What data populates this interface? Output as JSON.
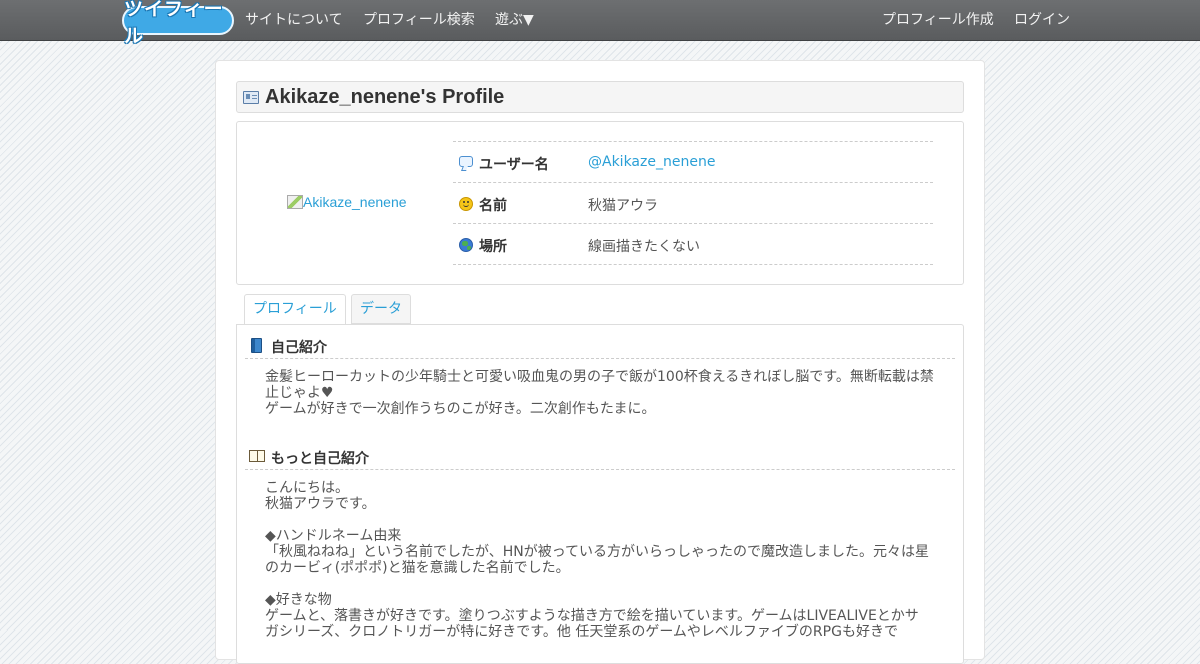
{
  "navbar": {
    "logo": "ツイフィール",
    "links": [
      "サイトについて",
      "プロフィール検索",
      "遊ぶ▼"
    ],
    "right_links": [
      "プロフィール作成",
      "ログイン"
    ]
  },
  "profile": {
    "title": "Akikaze_nenene's Profile",
    "avatar_alt": "Akikaze_nenene",
    "rows": [
      {
        "icon": "speech-bubble-icon",
        "label": "ユーザー名",
        "value": "@Akikaze_nenene"
      },
      {
        "icon": "smile-icon",
        "label": "名前",
        "value": "秋猫アウラ"
      },
      {
        "icon": "globe-icon",
        "label": "場所",
        "value": "線画描きたくない"
      }
    ]
  },
  "tabs": [
    "プロフィール",
    "データ"
  ],
  "sections": [
    {
      "icon": "blue-book-icon",
      "title": "自己紹介",
      "body": "金髪ヒーローカットの少年騎士と可愛い吸血鬼の男の子で飯が100杯食えるきれぼし脳です。無断転載は禁\n止じゃよ♥\nゲームが好きで一次創作うちのこが好き。二次創作もたまに。"
    },
    {
      "icon": "open-book-icon",
      "title": "もっと自己紹介",
      "body": "こんにちは。\n秋猫アウラです。\n\n◆ハンドルネーム由来\n「秋風ねねね」という名前でしたが、HNが被っている方がいらっしゃったので魔改造しました。元々は星\nのカービィ(ポポポ)と猫を意識した名前でした。\n\n◆好きな物\nゲームと、落書きが好きです。塗りつぶすような描き方で絵を描いています。ゲームはLIVEALIVEとかサ\nガシリーズ、クロノトリガーが特に好きです。他 任天堂系のゲームやレベルファイブのRPGも好きで"
    }
  ],
  "colors": {
    "navbar": "#5f6163",
    "link": "#2a9fd6",
    "logo": "#3fa9e6"
  }
}
